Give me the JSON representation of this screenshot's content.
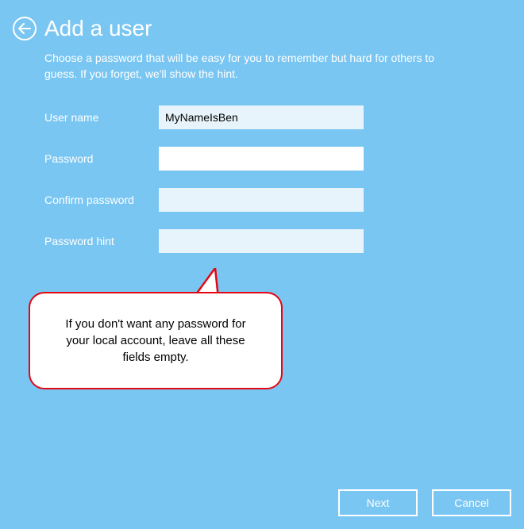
{
  "header": {
    "title": "Add a user",
    "subtitle": "Choose a password that will be easy for you to remember but hard for others to guess. If you forget, we'll show the hint."
  },
  "form": {
    "username_label": "User name",
    "username_value": "MyNameIsBen",
    "password_label": "Password",
    "password_value": "",
    "confirm_label": "Confirm password",
    "confirm_value": "",
    "hint_label": "Password hint",
    "hint_value": ""
  },
  "callout": {
    "text": "If you don't want any password for your local account, leave all these fields empty."
  },
  "footer": {
    "next_label": "Next",
    "cancel_label": "Cancel"
  }
}
